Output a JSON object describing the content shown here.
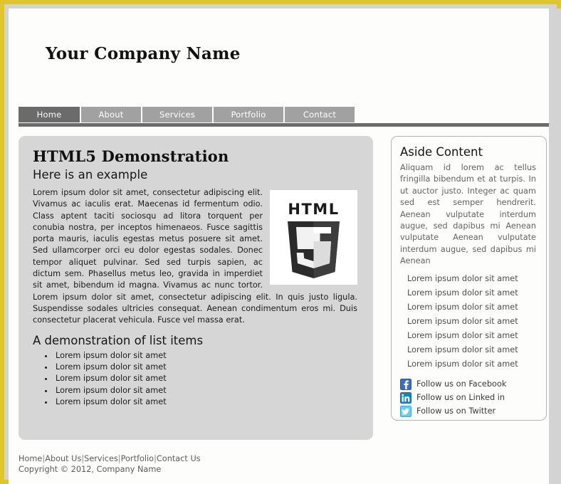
{
  "browser": {
    "frame_color": "#dfc62c",
    "page_background": "#fdfdfb",
    "scrollbar_color": "#d3d3d3"
  },
  "header": {
    "company_name": "Your Company Name"
  },
  "nav": {
    "items": [
      {
        "label": "Home",
        "active": true
      },
      {
        "label": "About",
        "active": false
      },
      {
        "label": "Services",
        "active": false
      },
      {
        "label": "Portfolio",
        "active": false
      },
      {
        "label": "Contact",
        "active": false
      }
    ],
    "active_color": "#6b6b6b",
    "inactive_color": "#a1a1a1"
  },
  "main": {
    "title": "HTML5 Demonstration",
    "subtitle": "Here is an example",
    "paragraph": "Lorem ipsum dolor sit amet, consectetur adipiscing elit. Vivamus ac iaculis erat. Maecenas id fermentum odio. Class aptent taciti sociosqu ad litora torquent per conubia nostra, per inceptos himenaeos. Fusce sagittis porta mauris, iaculis egestas metus posuere sit amet. Sed ullamcorper orci eu dolor egestas sodales. Donec tempor aliquet pulvinar. Sed sed turpis sapien, ac dictum sem. Phasellus metus leo, gravida in imperdiet sit amet, bibendum id magna. Vivamus ac nunc tortor. Lorem ipsum dolor sit amet, consectetur adipiscing elit. In quis justo ligula. Suspendisse sodales ultricies consequat. Aenean condimentum eros mi. Duis consectetur placerat vehicula. Fusce vel massa erat.",
    "image_alt": "HTML5",
    "image_text": "HTML",
    "image_number": "5",
    "list_title": "A demonstration of list items",
    "list_items": [
      "Lorem ipsum dolor sit amet",
      "Lorem ipsum dolor sit amet",
      "Lorem ipsum dolor sit amet",
      "Lorem ipsum dolor sit amet",
      "Lorem ipsum dolor sit amet"
    ],
    "background": "#d6d6d6"
  },
  "aside": {
    "title": "Aside Content",
    "paragraph": "Aliquam id lorem ac tellus fringilla bibendum et at turpis. In ut auctor justo. Integer ac quam sed est semper hendrerit. Aenean vulputate interdum augue, sed dapibus mi Aenean vulputate Aenean vulputate interdum augue, sed dapibus mi Aenean",
    "list_items": [
      "Lorem ipsum dolor sit amet",
      "Lorem ipsum dolor sit amet",
      "Lorem ipsum dolor sit amet",
      "Lorem ipsum dolor sit amet",
      "Lorem ipsum dolor sit amet",
      "Lorem ipsum dolor sit amet",
      "Lorem ipsum dolor sit amet"
    ],
    "social": [
      {
        "icon": "facebook-icon",
        "label": "Follow us on Facebook",
        "color": "#2f5c9e"
      },
      {
        "icon": "linkedin-icon",
        "label": "Follow us on Linked in",
        "color": "#0e76a8"
      },
      {
        "icon": "twitter-icon",
        "label": "Follow us on Twitter",
        "color": "#4ec2ee"
      }
    ]
  },
  "footer": {
    "links": [
      "Home",
      "About Us",
      "Services",
      "Portfolio",
      "Contact Us"
    ],
    "separator": "|",
    "copyright": "Copyright © 2012, Company Name"
  }
}
